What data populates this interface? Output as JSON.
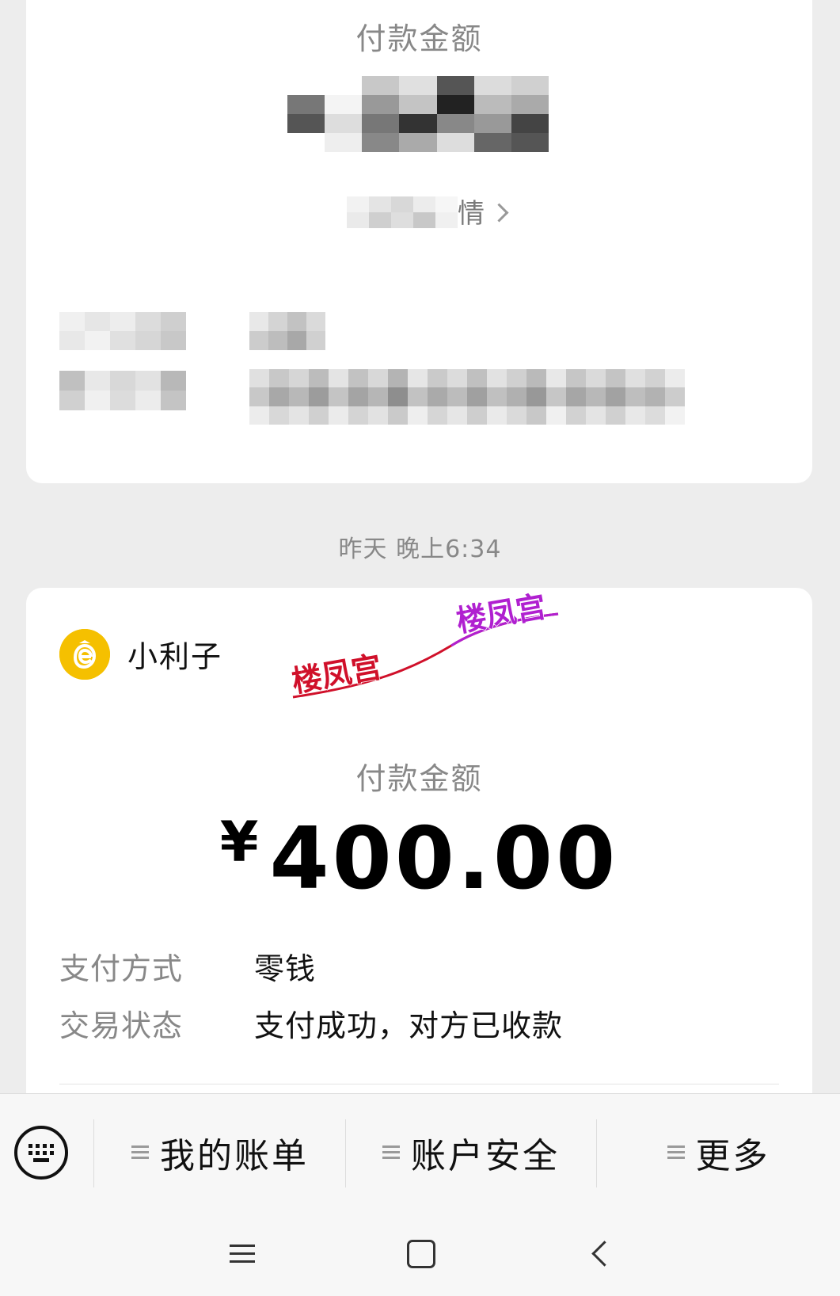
{
  "top_card": {
    "amount_label": "付款金额",
    "detail_link": "情"
  },
  "timestamp": "昨天 晚上6:34",
  "bottom_card": {
    "merchant": {
      "name": "小利子",
      "avatar_icon": "coin-bag-icon",
      "avatar_color": "#f5c000"
    },
    "amount_label": "付款金额",
    "currency": "¥",
    "amount": "400.00",
    "rows": [
      {
        "label": "支付方式",
        "value": "零钱"
      },
      {
        "label": "交易状态",
        "value": "支付成功，对方已收款"
      }
    ]
  },
  "watermark": {
    "text": "楼凤宫",
    "colors": [
      "#d0102a",
      "#b020d0"
    ]
  },
  "toolbar": {
    "keyboard_icon": "keyboard-icon",
    "items": [
      {
        "label": "我的账单"
      },
      {
        "label": "账户安全"
      },
      {
        "label": "更多"
      }
    ]
  },
  "system_nav": {
    "icons": [
      "menu-icon",
      "home-icon",
      "back-icon"
    ]
  }
}
